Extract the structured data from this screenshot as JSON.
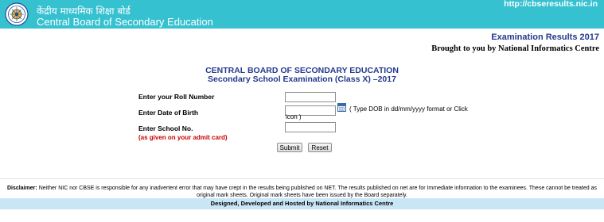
{
  "header": {
    "hindi_title": "केंद्रीय माध्यमिक शिक्षा बोर्ड",
    "english_title": "Central Board of Secondary Education",
    "site_url": "http://cbseresults.nic.in",
    "logo": "cbse-seal-logo"
  },
  "subheader": {
    "exam_results": "Examination Results 2017",
    "brought_by": "Brought to you by National Informatics Centre"
  },
  "form": {
    "heading_line1": "CENTRAL BOARD OF SECONDARY EDUCATION",
    "heading_line2": "Secondary School Examination (Class X) –2017",
    "roll_label": "Enter your Roll Number",
    "roll_value": "",
    "dob_label": "Enter Date of Birth",
    "dob_value": "",
    "dob_hint": "( Type DOB in dd/mm/yyyy format or Click icon )",
    "calendar_icon": "calendar-icon",
    "school_label": "Enter School No.",
    "school_value": "",
    "school_note": "(as given on your admit card)",
    "submit_label": "Submit",
    "reset_label": "Reset"
  },
  "footer": {
    "disclaimer_label": "Disclaimer:",
    "disclaimer_text": " Neither NIC nor CBSE is responsible for any inadvertent error that may have crept in the results being published on NET. The results published on net are for Immediate information to the examinees. These cannot be treated as original mark sheets. Original mark sheets have been issued by the Board separately.",
    "credit": "Designed, Developed and Hosted by National Informatics Centre"
  },
  "colors": {
    "banner": "#36c1d0",
    "heading_blue": "#243a8f",
    "note_red": "#cc0000",
    "footer_band": "#c9e6f7"
  }
}
